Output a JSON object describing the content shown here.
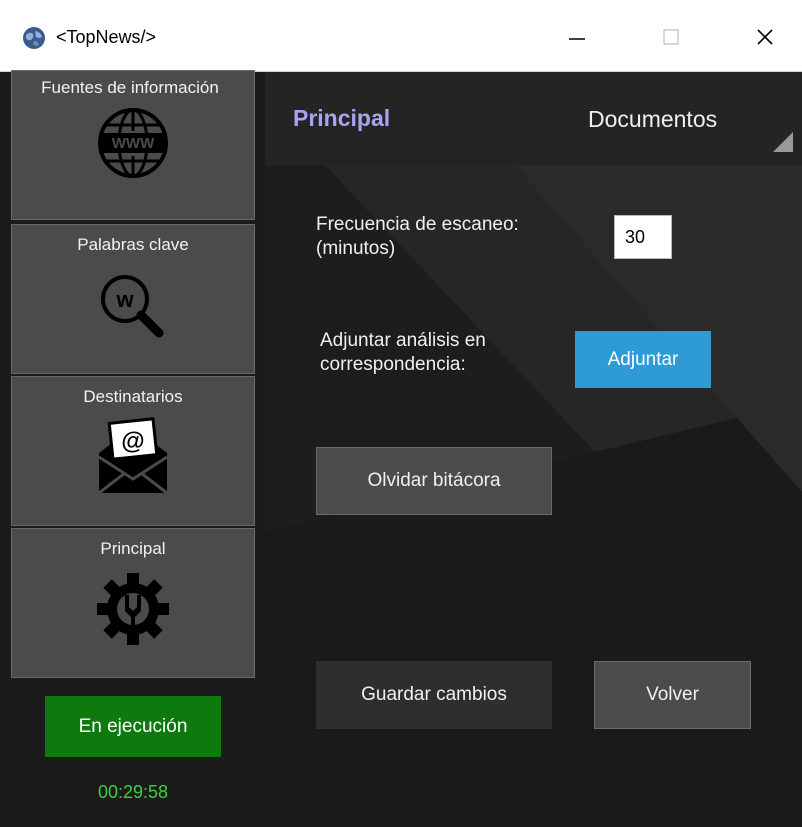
{
  "window": {
    "title": "<TopNews/>",
    "minimize_glyph": "—",
    "close_glyph": "✕"
  },
  "sidebar": {
    "items": [
      {
        "label": "Fuentes de información",
        "icon": "globe-www-icon"
      },
      {
        "label": "Palabras clave",
        "icon": "keyword-search-icon"
      },
      {
        "label": "Destinatarios",
        "icon": "mail-envelope-icon"
      },
      {
        "label": "Principal",
        "icon": "settings-gear-icon"
      }
    ],
    "status_label": "En ejecución",
    "timer": "00:29:58"
  },
  "main": {
    "tabs": [
      {
        "label": "Principal",
        "active": true
      },
      {
        "label": "Documentos",
        "active": false
      }
    ],
    "frequency": {
      "label_line1": "Frecuencia de escaneo:",
      "label_line2": "(minutos)",
      "value": "30"
    },
    "attach": {
      "label_line1": "Adjuntar análisis en",
      "label_line2": "correspondencia:",
      "button_label": "Adjuntar"
    },
    "forget_log_label": "Olvidar bitácora",
    "save_label": "Guardar cambios",
    "back_label": "Volver"
  },
  "colors": {
    "accent_tab": "#a9a4f2",
    "attach_button": "#2e9bd6",
    "status_running": "#0e7a0e",
    "timer": "#3ecf3e"
  }
}
